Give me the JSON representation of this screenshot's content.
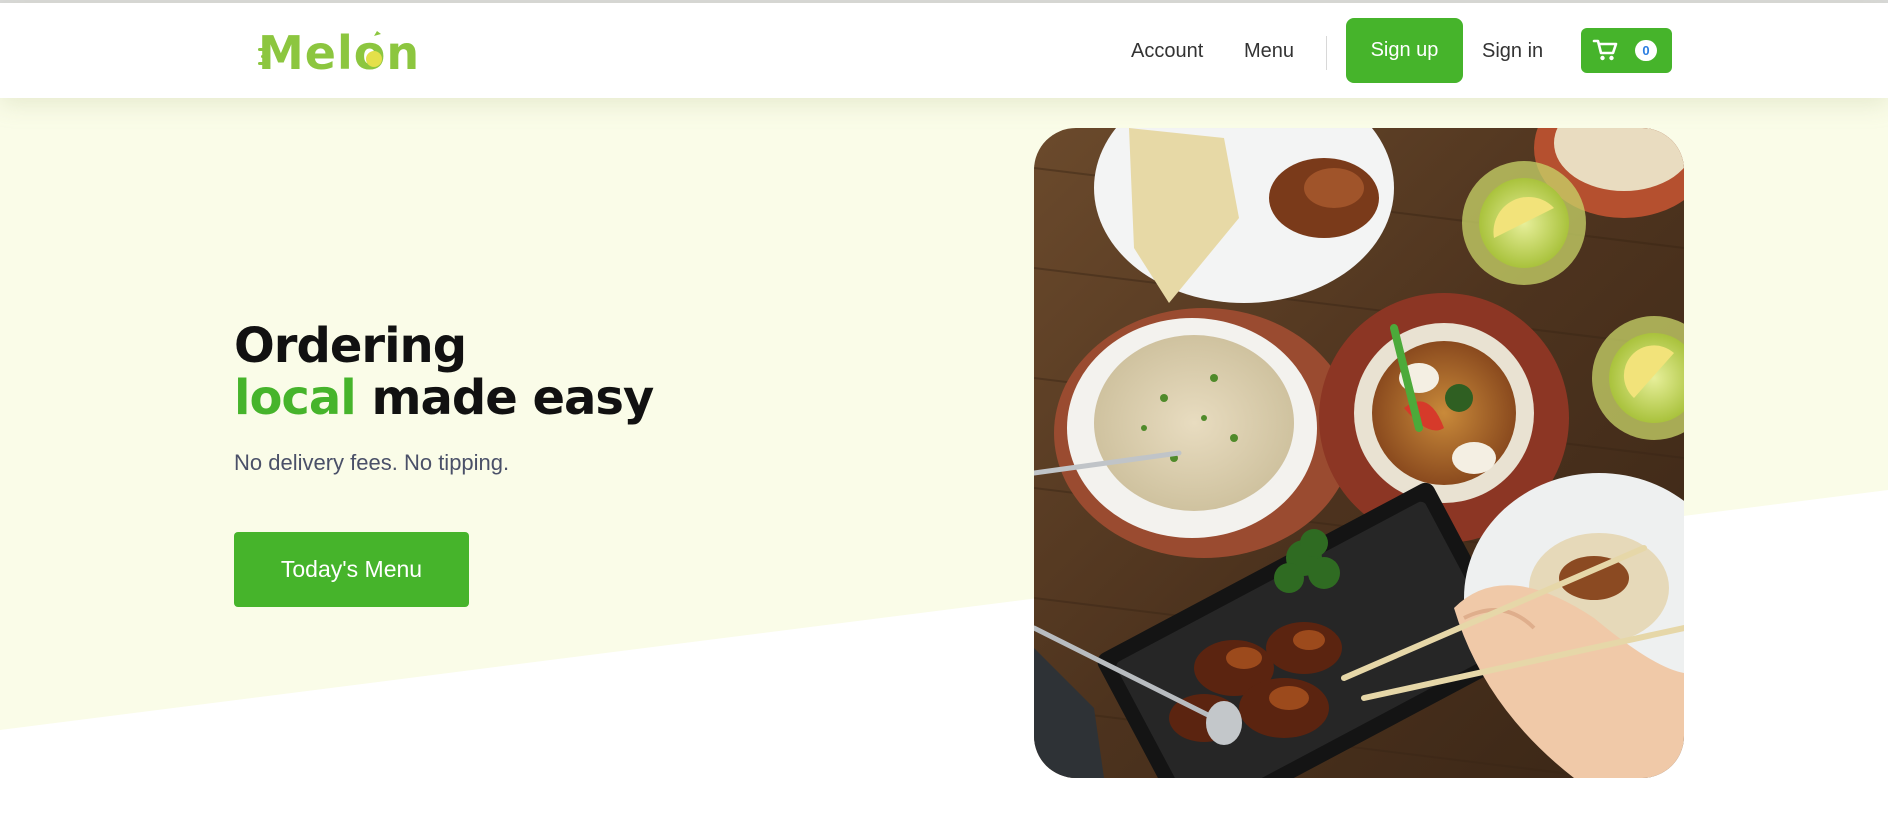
{
  "brand": {
    "name": "Melon",
    "color": "#8cc63f",
    "icon": "melon-logo"
  },
  "nav": {
    "account": "Account",
    "menu": "Menu",
    "signup": "Sign up",
    "signin": "Sign in",
    "cart_icon": "cart-icon",
    "cart_count": "0"
  },
  "hero": {
    "title_line1": "Ordering",
    "title_accent": "local",
    "title_rest": "made easy",
    "subtitle": "No delivery fees. No tipping.",
    "cta": "Today's Menu",
    "image": "food-table-photo"
  },
  "colors": {
    "accent": "#46b42b",
    "hero_background": "#fafce8",
    "text": "#111111",
    "subtitle": "#4a5068"
  }
}
